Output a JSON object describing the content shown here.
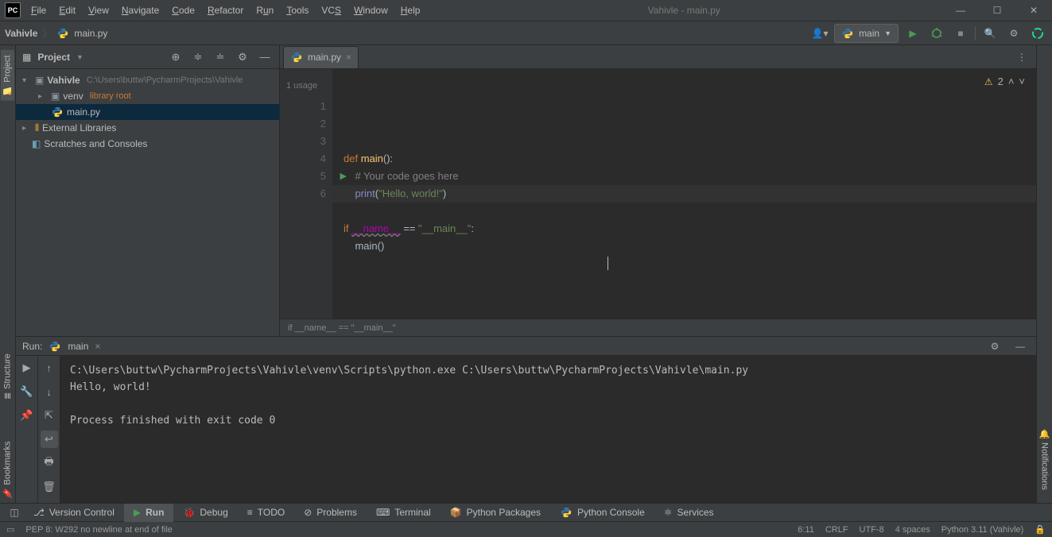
{
  "window": {
    "title": "Vahivle - main.py",
    "app_abbrev": "PC"
  },
  "menu": [
    "File",
    "Edit",
    "View",
    "Navigate",
    "Code",
    "Refactor",
    "Run",
    "Tools",
    "VCS",
    "Window",
    "Help"
  ],
  "breadcrumb": {
    "project": "Vahivle",
    "file": "main.py"
  },
  "run_config": {
    "name": "main"
  },
  "project_panel": {
    "title": "Project",
    "root": {
      "name": "Vahivle",
      "path": "C:\\Users\\buttw\\PycharmProjects\\Vahivle"
    },
    "venv": {
      "name": "venv",
      "hint": "library root"
    },
    "file": "main.py",
    "ext_libs": "External Libraries",
    "scratches": "Scratches and Consoles"
  },
  "editor": {
    "tab": "main.py",
    "usage_hint": "1 usage",
    "warnings_count": "2",
    "lines": [
      "1",
      "2",
      "3",
      "4",
      "5",
      "6"
    ],
    "code": {
      "l1_def": "def ",
      "l1_fn": "main",
      "l1_rest": "():",
      "l2_cm": "# Your code goes here",
      "l3_print": "print",
      "l3_open": "(",
      "l3_str": "\"Hello, world!\"",
      "l3_close": ")",
      "l5_if": "if ",
      "l5_name": "__name__",
      "l5_eq": " == ",
      "l5_main": "\"__main__\"",
      "l5_colon": ":",
      "l6_call": "main",
      "l6_p": "()"
    },
    "breadcrumb_scope": "if __name__ == \"__main__\""
  },
  "run_panel": {
    "label": "Run:",
    "tab": "main",
    "console": "C:\\Users\\buttw\\PycharmProjects\\Vahivle\\venv\\Scripts\\python.exe C:\\Users\\buttw\\PycharmProjects\\Vahivle\\main.py\nHello, world!\n\nProcess finished with exit code 0"
  },
  "bottom_tabs": {
    "vcs": "Version Control",
    "run": "Run",
    "debug": "Debug",
    "todo": "TODO",
    "problems": "Problems",
    "terminal": "Terminal",
    "pypkg": "Python Packages",
    "pycon": "Python Console",
    "services": "Services"
  },
  "status": {
    "pep": "PEP 8: W292 no newline at end of file",
    "pos": "6:11",
    "sep": "CRLF",
    "enc": "UTF-8",
    "indent": "4 spaces",
    "interp": "Python 3.11 (Vahivle)"
  },
  "side_tabs": {
    "project": "Project",
    "structure": "Structure",
    "bookmarks": "Bookmarks",
    "notifications": "Notifications"
  }
}
